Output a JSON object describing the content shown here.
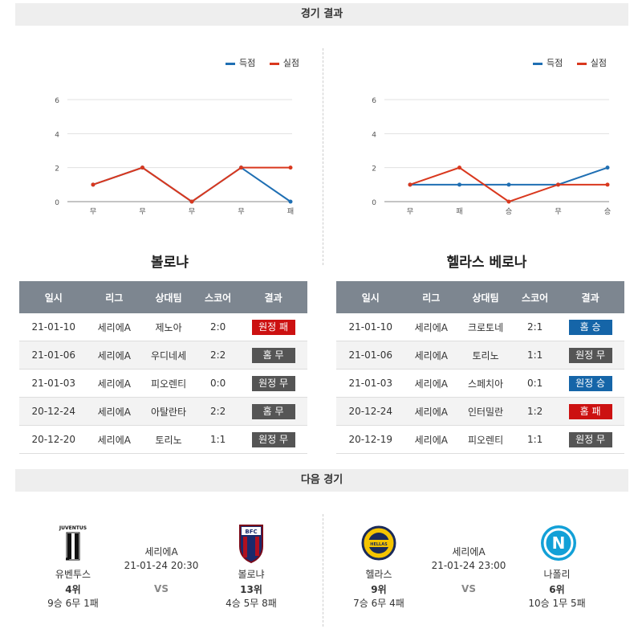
{
  "sections": {
    "results_title": "경기 결과",
    "next_title": "다음 경기"
  },
  "legend": {
    "scored_label": "득점",
    "conceded_label": "실점",
    "scored_color": "#1f6fb3",
    "conceded_color": "#d9381e"
  },
  "colors": {
    "loss": "#cc1111",
    "draw": "#555555",
    "win": "#1565a8",
    "header_bg": "#7d8690"
  },
  "table_headers": [
    "일시",
    "리그",
    "상대팀",
    "스코어",
    "결과"
  ],
  "chart_data": [
    {
      "type": "line",
      "categories": [
        "무",
        "무",
        "무",
        "무",
        "패"
      ],
      "ylim": [
        0,
        6
      ],
      "yticks": [
        "0",
        "2",
        "4",
        "6"
      ],
      "grid": true,
      "legend_position": "top-right",
      "series": [
        {
          "name": "득점",
          "color": "#1f6fb3",
          "values": [
            1,
            2,
            0,
            2,
            0
          ]
        },
        {
          "name": "실점",
          "color": "#d9381e",
          "values": [
            1,
            2,
            0,
            2,
            2
          ]
        }
      ]
    },
    {
      "type": "line",
      "categories": [
        "무",
        "패",
        "승",
        "무",
        "승"
      ],
      "ylim": [
        0,
        6
      ],
      "yticks": [
        "0",
        "2",
        "4",
        "6"
      ],
      "grid": true,
      "legend_position": "top-right",
      "series": [
        {
          "name": "득점",
          "color": "#1f6fb3",
          "values": [
            1,
            1,
            1,
            1,
            2
          ]
        },
        {
          "name": "실점",
          "color": "#d9381e",
          "values": [
            1,
            2,
            0,
            1,
            1
          ]
        }
      ]
    }
  ],
  "teams": [
    {
      "name": "볼로냐",
      "matches": [
        {
          "date": "21-01-10",
          "league": "세리에A",
          "opponent": "제노아",
          "score": "2:0",
          "result": "원정 패",
          "type": "loss"
        },
        {
          "date": "21-01-06",
          "league": "세리에A",
          "opponent": "우디네세",
          "score": "2:2",
          "result": "홈 무",
          "type": "draw"
        },
        {
          "date": "21-01-03",
          "league": "세리에A",
          "opponent": "피오렌티",
          "score": "0:0",
          "result": "원정 무",
          "type": "draw"
        },
        {
          "date": "20-12-24",
          "league": "세리에A",
          "opponent": "아탈란타",
          "score": "2:2",
          "result": "홈 무",
          "type": "draw"
        },
        {
          "date": "20-12-20",
          "league": "세리에A",
          "opponent": "토리노",
          "score": "1:1",
          "result": "원정 무",
          "type": "draw"
        }
      ]
    },
    {
      "name": "헬라스 베로나",
      "matches": [
        {
          "date": "21-01-10",
          "league": "세리에A",
          "opponent": "크로토네",
          "score": "2:1",
          "result": "홈 승",
          "type": "win"
        },
        {
          "date": "21-01-06",
          "league": "세리에A",
          "opponent": "토리노",
          "score": "1:1",
          "result": "원정 무",
          "type": "draw"
        },
        {
          "date": "21-01-03",
          "league": "세리에A",
          "opponent": "스페치아",
          "score": "0:1",
          "result": "원정 승",
          "type": "win"
        },
        {
          "date": "20-12-24",
          "league": "세리에A",
          "opponent": "인터밀란",
          "score": "1:2",
          "result": "홈 패",
          "type": "loss"
        },
        {
          "date": "20-12-19",
          "league": "세리에A",
          "opponent": "피오렌티",
          "score": "1:1",
          "result": "원정 무",
          "type": "draw"
        }
      ]
    }
  ],
  "next_matches": [
    {
      "home": {
        "name": "유벤투스",
        "rank": "4위",
        "record": "9승 6무 1패",
        "logo_icon": "juventus-logo",
        "logo_text": "JUVENTUS"
      },
      "league": "세리에A",
      "datetime": "21-01-24 20:30",
      "vs": "VS",
      "away": {
        "name": "볼로냐",
        "rank": "13위",
        "record": "4승 5무 8패",
        "logo_icon": "bologna-logo",
        "logo_text": "BFC"
      }
    },
    {
      "home": {
        "name": "헬라스",
        "rank": "9위",
        "record": "7승 6무 4패",
        "logo_icon": "hellas-verona-logo",
        "logo_text": "HELLAS VERONA"
      },
      "league": "세리에A",
      "datetime": "21-01-24 23:00",
      "vs": "VS",
      "away": {
        "name": "나폴리",
        "rank": "6위",
        "record": "10승 1무 5패",
        "logo_icon": "napoli-logo",
        "logo_text": "N"
      }
    }
  ]
}
